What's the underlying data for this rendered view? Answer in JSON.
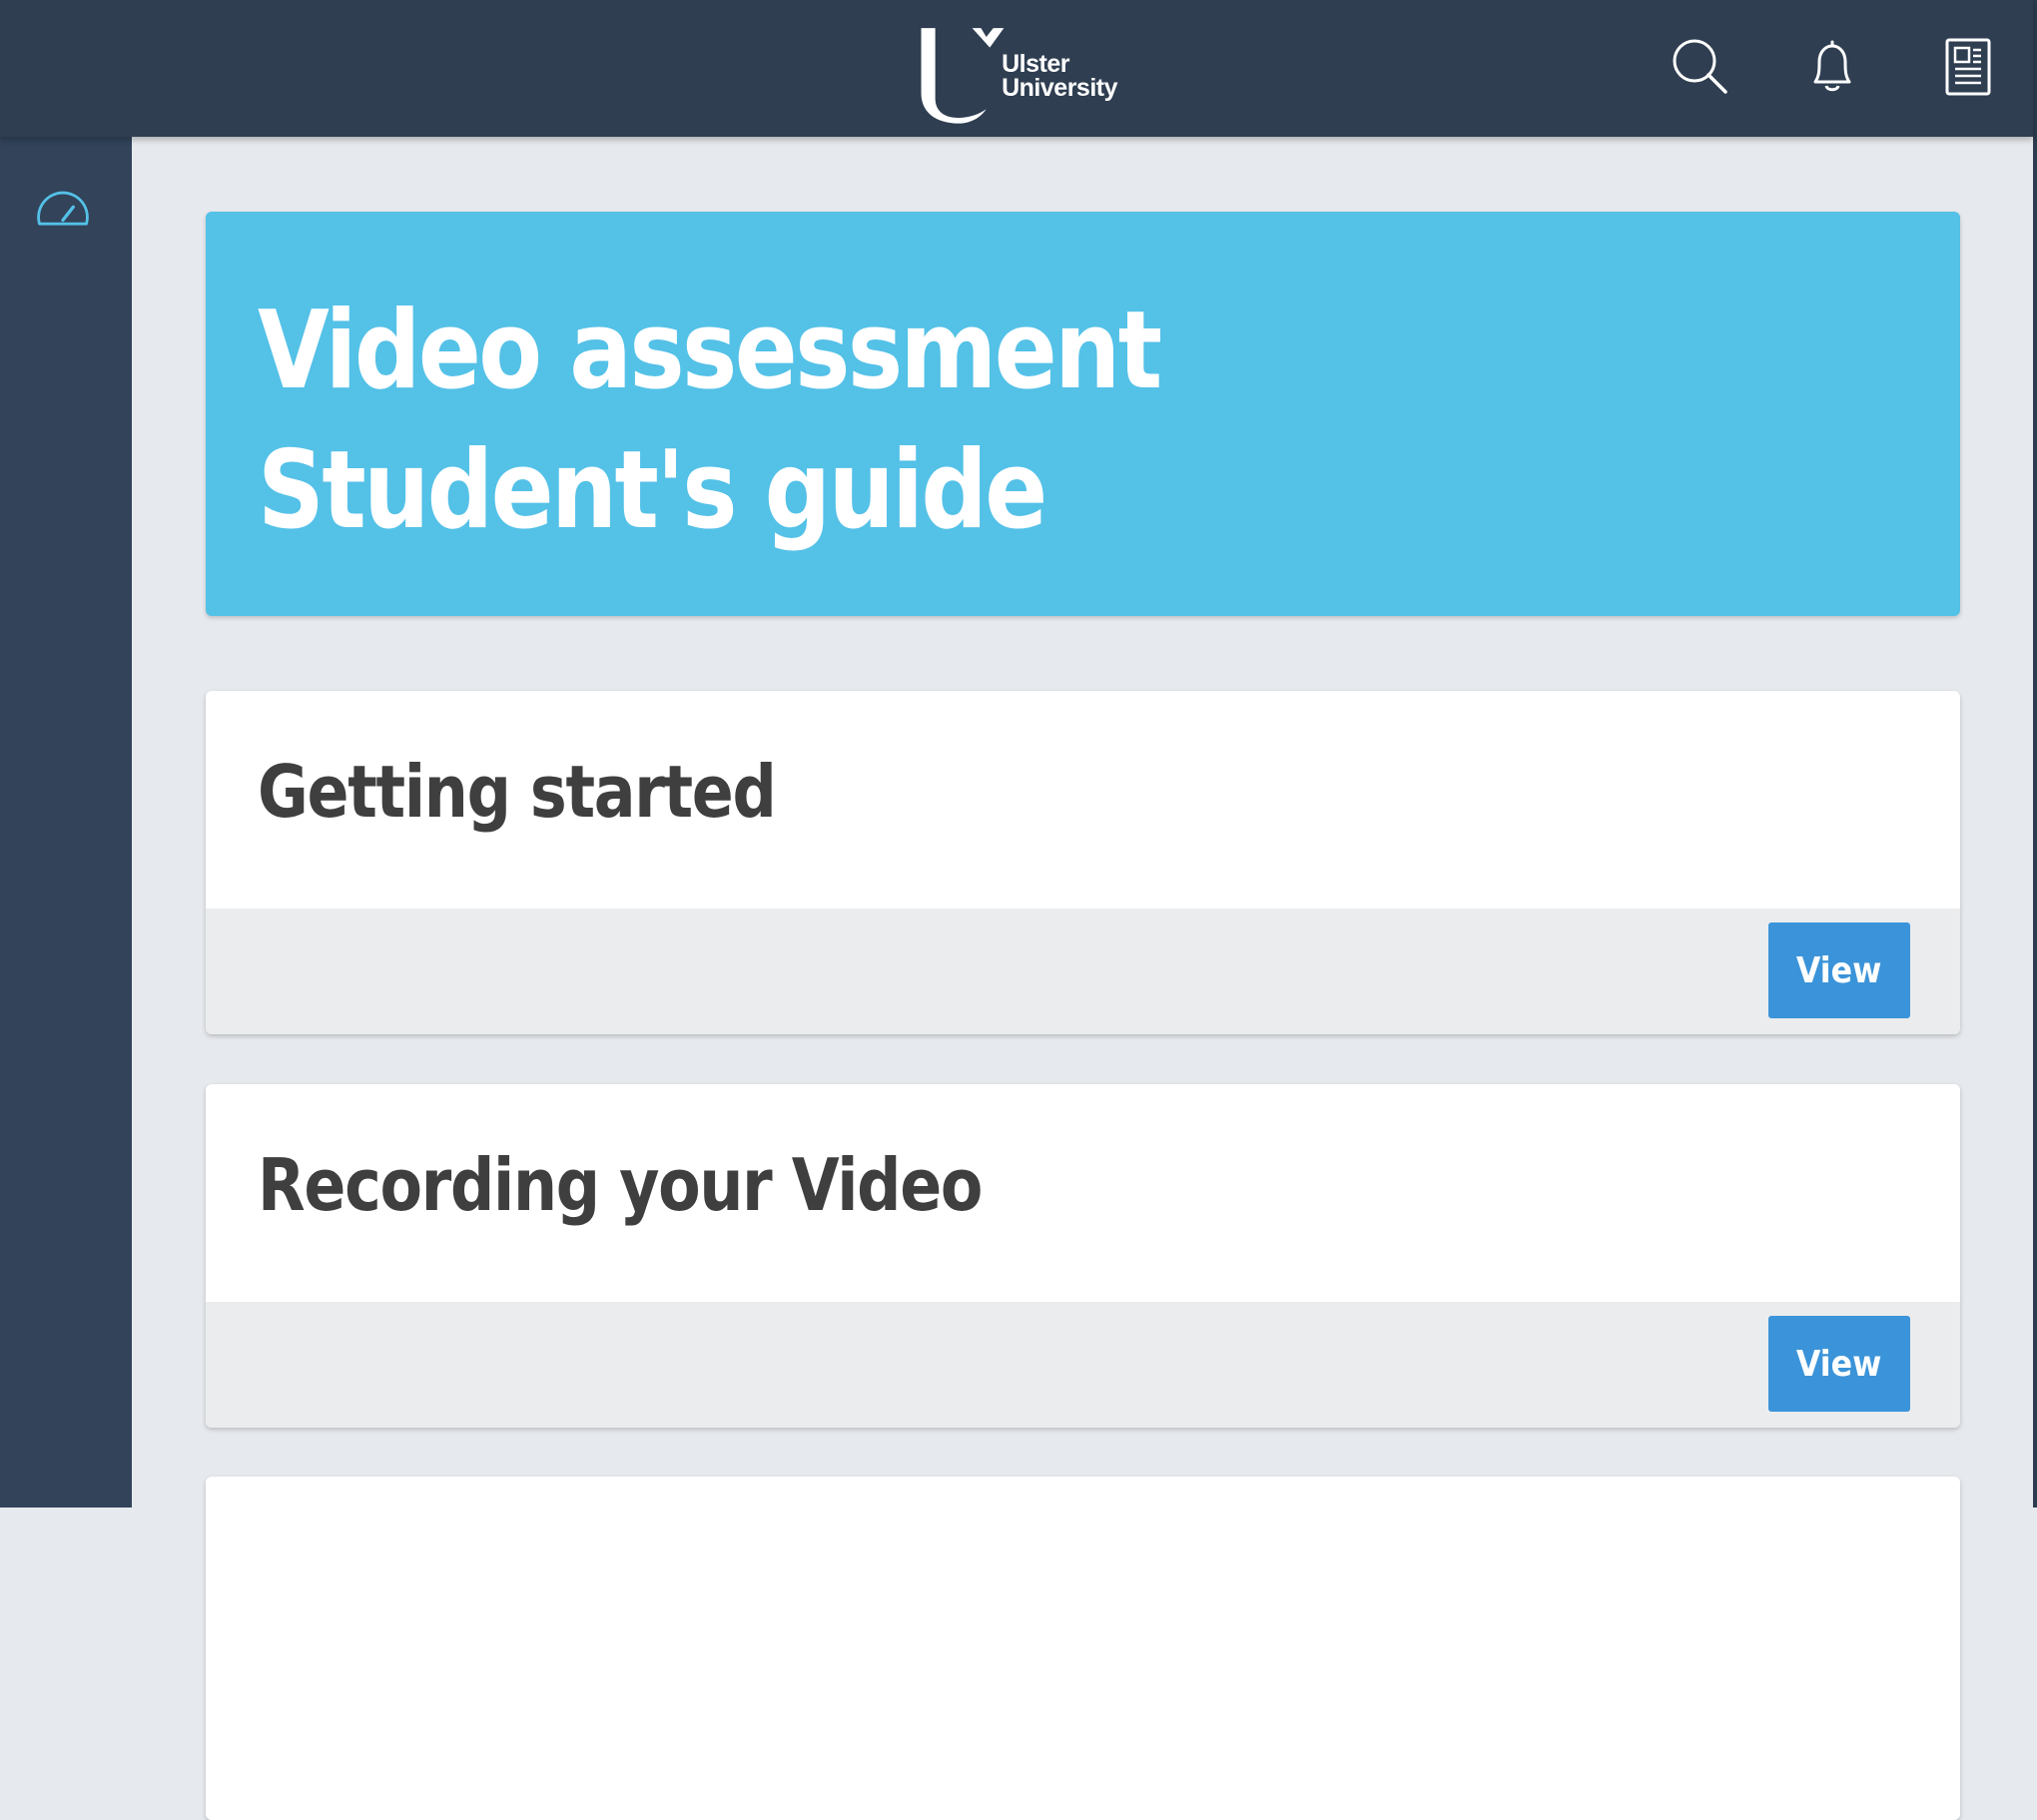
{
  "header": {
    "logo": {
      "line1": "Ulster",
      "line2": "University"
    },
    "icons": [
      "search-icon",
      "bell-icon",
      "document-icon"
    ]
  },
  "sidebar": {
    "icons": [
      "dashboard-icon"
    ]
  },
  "hero": {
    "title_line1": "Video assessment",
    "title_line2": "Student's guide"
  },
  "cards": [
    {
      "title": "Getting started",
      "button": "View"
    },
    {
      "title": "Recording your Video",
      "button": "View"
    }
  ],
  "colors": {
    "topbar": "#2f3e51",
    "sidebar": "#32435a",
    "hero": "#54c1e7",
    "button": "#3b94d9",
    "background": "#e6e9ed"
  }
}
